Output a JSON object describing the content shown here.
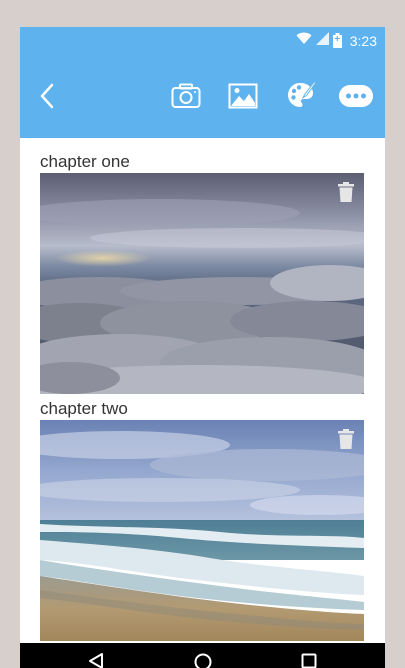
{
  "status_bar": {
    "time": "3:23",
    "battery_symbol": "+",
    "icons": [
      "wifi-icon",
      "signal-icon",
      "battery-charging-icon"
    ]
  },
  "toolbar": {
    "back_icon": "back-arrow-icon",
    "actions": [
      "camera-icon",
      "image-icon",
      "palette-icon",
      "more-icon"
    ],
    "color": "#5eb3ef"
  },
  "chapters": [
    {
      "title": "chapter one",
      "image": "cloudscape-photo",
      "delete_icon": "trash-icon"
    },
    {
      "title": "chapter two",
      "image": "beach-waves-photo",
      "delete_icon": "trash-icon"
    }
  ],
  "nav_bar": {
    "buttons": [
      "back-triangle-icon",
      "home-circle-icon",
      "recents-square-icon"
    ]
  }
}
